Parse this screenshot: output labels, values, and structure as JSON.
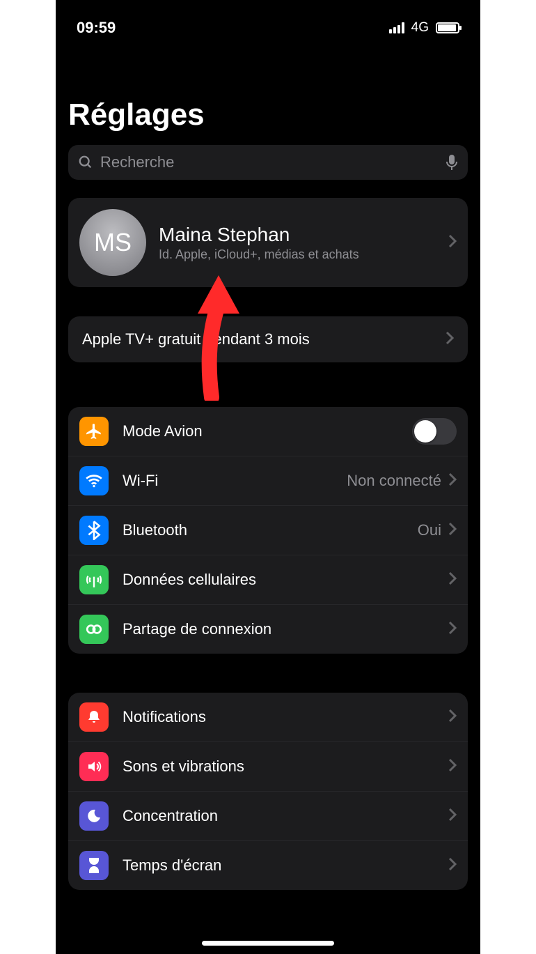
{
  "status": {
    "time": "09:59",
    "network_label": "4G"
  },
  "page": {
    "title": "Réglages"
  },
  "search": {
    "placeholder": "Recherche"
  },
  "account": {
    "initials": "MS",
    "name": "Maina Stephan",
    "subtitle": "Id. Apple, iCloud+, médias et achats"
  },
  "promo": {
    "label": "Apple TV+ gratuit pendant 3 mois"
  },
  "group_connectivity": {
    "airplane": {
      "label": "Mode Avion",
      "toggle_on": false
    },
    "wifi": {
      "label": "Wi-Fi",
      "detail": "Non connecté"
    },
    "bluetooth": {
      "label": "Bluetooth",
      "detail": "Oui"
    },
    "cellular": {
      "label": "Données cellulaires"
    },
    "hotspot": {
      "label": "Partage de connexion"
    }
  },
  "group_notifications": {
    "notifications": {
      "label": "Notifications"
    },
    "sounds": {
      "label": "Sons et vibrations"
    },
    "focus": {
      "label": "Concentration"
    },
    "screentime": {
      "label": "Temps d'écran"
    }
  }
}
